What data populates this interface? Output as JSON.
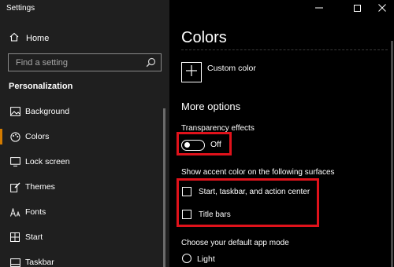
{
  "window": {
    "title": "Settings",
    "controls": [
      "minimize-icon",
      "maximize-icon",
      "close-icon"
    ]
  },
  "nav": {
    "home_label": "Home",
    "search_placeholder": "Find a setting",
    "section_title": "Personalization",
    "items": [
      {
        "label": "Background",
        "icon": "background-image-icon"
      },
      {
        "label": "Colors",
        "icon": "palette-icon",
        "selected": true
      },
      {
        "label": "Lock screen",
        "icon": "lock-screen-icon"
      },
      {
        "label": "Themes",
        "icon": "themes-brush-icon"
      },
      {
        "label": "Fonts",
        "icon": "fonts-icon"
      },
      {
        "label": "Start",
        "icon": "start-grid-icon"
      },
      {
        "label": "Taskbar",
        "icon": "taskbar-icon"
      }
    ]
  },
  "content": {
    "page_title": "Colors",
    "custom_color_label": "Custom color",
    "more_options_title": "More options",
    "transparency_label": "Transparency effects",
    "transparency_state": "Off",
    "transparency_on": false,
    "accent_surfaces_label": "Show accent color on the following surfaces",
    "checkboxes": [
      {
        "label": "Start, taskbar, and action center",
        "checked": false
      },
      {
        "label": "Title bars",
        "checked": false
      }
    ],
    "app_mode_label": "Choose your default app mode",
    "app_mode_options": [
      {
        "label": "Light",
        "selected": false
      }
    ]
  },
  "colors": {
    "accent": "#d37b00",
    "highlight": "#e0121b",
    "nav_bg": "#1f1f1f",
    "content_bg": "#000000"
  }
}
